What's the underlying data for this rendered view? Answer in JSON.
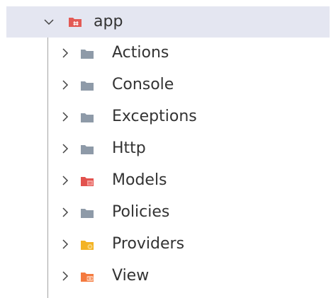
{
  "explorer": {
    "root": {
      "label": "app",
      "expanded": true,
      "icon": "folder-app-icon",
      "color": "#e35a55"
    },
    "children": [
      {
        "label": "Actions",
        "icon": "folder-icon",
        "color": "#8e9aa8"
      },
      {
        "label": "Console",
        "icon": "folder-icon",
        "color": "#8e9aa8"
      },
      {
        "label": "Exceptions",
        "icon": "folder-icon",
        "color": "#8e9aa8"
      },
      {
        "label": "Http",
        "icon": "folder-icon",
        "color": "#8e9aa8"
      },
      {
        "label": "Models",
        "icon": "folder-models-icon",
        "color": "#e2524e"
      },
      {
        "label": "Policies",
        "icon": "folder-icon",
        "color": "#8e9aa8"
      },
      {
        "label": "Providers",
        "icon": "folder-providers-icon",
        "color": "#f3b324"
      },
      {
        "label": "View",
        "icon": "folder-view-icon",
        "color": "#f47a3f"
      }
    ]
  },
  "colors": {
    "selection": "#e4e6f1",
    "chevron": "#444444",
    "indent_guide": "#a3a3a3",
    "text": "#333333"
  }
}
